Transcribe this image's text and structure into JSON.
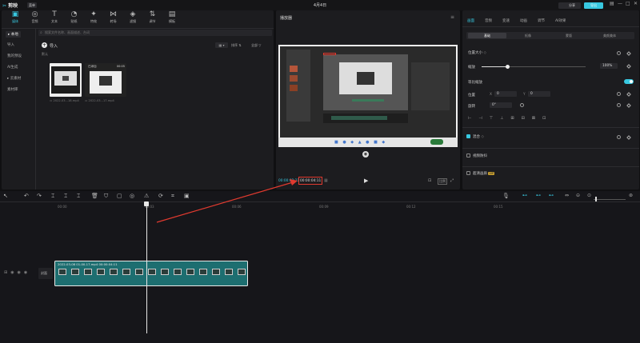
{
  "app": {
    "logo_text": "剪映",
    "menu_label": "菜单",
    "project_title": "4月4日"
  },
  "titlebar_right": {
    "vip_label": "VIP",
    "share_label": "分享",
    "export_label": "导出"
  },
  "media_toolbar": [
    {
      "label": "媒体",
      "icon": "media-icon",
      "glyph": "▣"
    },
    {
      "label": "音频",
      "icon": "audio-icon",
      "glyph": "◎"
    },
    {
      "label": "文本",
      "icon": "text-icon",
      "glyph": "T"
    },
    {
      "label": "贴纸",
      "icon": "sticker-icon",
      "glyph": "◔"
    },
    {
      "label": "特效",
      "icon": "effects-icon",
      "glyph": "✦"
    },
    {
      "label": "转场",
      "icon": "transition-icon",
      "glyph": "⋈"
    },
    {
      "label": "滤镜",
      "icon": "filter-icon",
      "glyph": "◈"
    },
    {
      "label": "调节",
      "icon": "adjust-icon",
      "glyph": "⇅"
    },
    {
      "label": "模板",
      "icon": "template-icon",
      "glyph": "▤"
    }
  ],
  "media_sidebar": [
    "本地",
    "导入",
    "我的预设",
    "AI生成",
    "云素材",
    "素材库"
  ],
  "media_search_placeholder": "搜索文件名称、画面描述、台词",
  "media_import_label": "导入",
  "media_view_buttons": {
    "sort": "排序",
    "all": "全部"
  },
  "media_section_label": "默认",
  "media_items": [
    {
      "name": "2022-03...18.mp4",
      "duration": ""
    },
    {
      "name": "2022-03...17.mp4",
      "duration": "00:05"
    }
  ],
  "player": {
    "title": "播放器",
    "current_time": "00:00:02:21",
    "total_time": "00:00:04:11",
    "buttons": {
      "ratio": "比例"
    }
  },
  "props": {
    "tabs": [
      "画面",
      "音频",
      "变速",
      "动画",
      "调节",
      "AI效果"
    ],
    "segments": [
      "基础",
      "抠像",
      "蒙版",
      "美颜美体"
    ],
    "position_size_label": "位置大小",
    "scale_label": "缩放",
    "scale_value": "100%",
    "uniform_scale_label": "等比缩放",
    "position_label": "位置",
    "position_x": "0",
    "position_y": "0",
    "x_label": "X",
    "y_label": "Y",
    "rotate_label": "旋转",
    "rotate_value": "0°",
    "blend_label": "混合",
    "stabilize_label": "视频防抖",
    "super_label": "超清画质",
    "super_badge": "VIP"
  },
  "timeline": {
    "ruler": [
      "00:00",
      "00:03",
      "00:06",
      "00:09",
      "00:12",
      "00:15"
    ],
    "clip_label": "2022-03-08 01-00-17.mp4",
    "clip_duration": "00:00:04:11",
    "track_label": "封面"
  },
  "colors": {
    "accent": "#38c8e0",
    "clip": "#1d6e70",
    "red_box": "#e03a2f"
  }
}
